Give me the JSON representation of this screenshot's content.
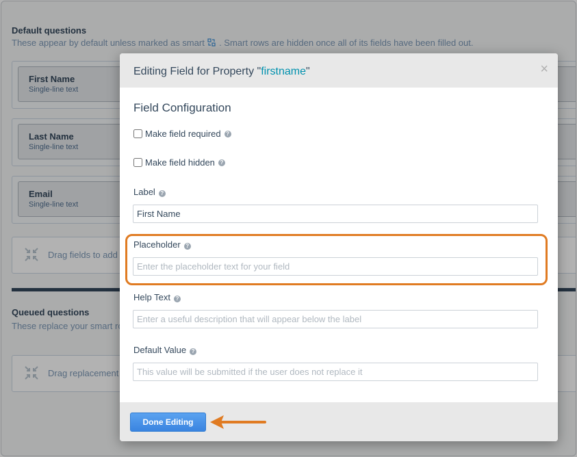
{
  "background": {
    "default_title": "Default questions",
    "default_desc_part1": "These appear by default unless marked as smart",
    "default_desc_part2": ". Smart rows are hidden once all of its fields have been filled out.",
    "fields": [
      {
        "name": "First Name",
        "type": "Single-line text"
      },
      {
        "name": "Last Name",
        "type": "Single-line text"
      },
      {
        "name": "Email",
        "type": "Single-line text"
      }
    ],
    "drop_text": "Drag fields to add",
    "queued_title": "Queued questions",
    "queued_desc": "These replace your smart ro",
    "drop_replacement_text": "Drag replacement"
  },
  "modal": {
    "title_prefix": "Editing Field for Property \"",
    "property_name": "firstname",
    "title_suffix": "\"",
    "close_symbol": "×",
    "config_heading": "Field Configuration",
    "required_label": "Make field required",
    "hidden_label": "Make field hidden",
    "label_label": "Label",
    "label_value": "First Name",
    "placeholder_label": "Placeholder",
    "placeholder_placeholder": "Enter the placeholder text for your field",
    "help_label": "Help Text",
    "help_placeholder": "Enter a useful description that will appear below the label",
    "default_label": "Default Value",
    "default_placeholder": "This value will be submitted if the user does not replace it",
    "done_label": "Done Editing"
  },
  "colors": {
    "highlight": "#e07b22",
    "accent": "#0091ae",
    "button": "#3a84e0"
  }
}
